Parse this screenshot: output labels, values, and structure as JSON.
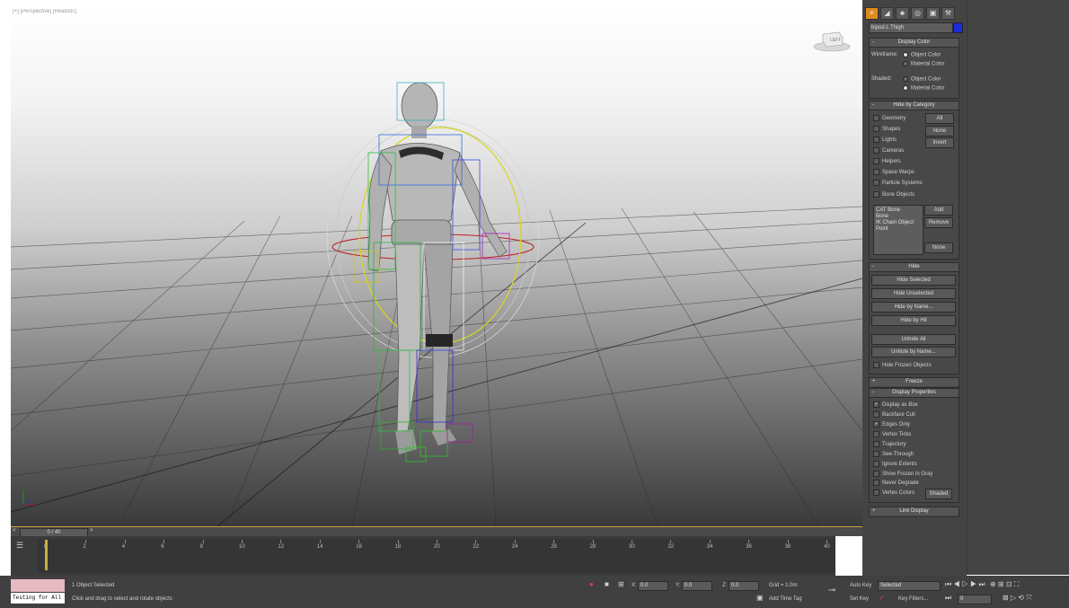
{
  "viewport": {
    "label": "[+] [Perspective] [Realistic]",
    "viewcube_label": "LEFT"
  },
  "command_panel": {
    "tabs": [
      "create",
      "modify",
      "hierarchy",
      "motion",
      "display",
      "utilities"
    ],
    "object_name": "bipod L Thigh",
    "color_swatch": "#1b2dd8",
    "display_color": {
      "title": "Display Color",
      "wireframe_label": "Wireframe:",
      "shaded_label": "Shaded:",
      "opt_object": "Object Color",
      "opt_material": "Material Color"
    },
    "hide_by_category": {
      "title": "Hide by Category",
      "items": [
        "Geometry",
        "Shapes",
        "Lights",
        "Cameras",
        "Helpers",
        "Space Warps",
        "Particle Systems",
        "Bone Objects"
      ],
      "btn_all": "All",
      "btn_none": "None",
      "btn_invert": "Invert",
      "list": [
        "CAT Bone",
        "Bone",
        "IK Chain Object",
        "Point"
      ],
      "btn_add": "Add",
      "btn_remove": "Remove",
      "btn_none2": "None"
    },
    "hide": {
      "title": "Hide",
      "buttons": [
        "Hide Selected",
        "Hide Unselected",
        "Hide by Name...",
        "Hide by Hit",
        "Unhide All",
        "Unhide by Name..."
      ],
      "frozen": "Hide Frozen Objects"
    },
    "freeze": {
      "title": "Freeze"
    },
    "display_properties": {
      "title": "Display Properties",
      "items": [
        "Display as Box",
        "Backface Cull",
        "Edges Only",
        "Vertex Ticks",
        "Trajectory",
        "See-Through",
        "Ignore Extents",
        "Show Frozen in Gray",
        "Never Degrade",
        "Vertex Colors"
      ],
      "checked": [
        true,
        false,
        true,
        false,
        false,
        false,
        false,
        false,
        false,
        false
      ],
      "shaded_btn": "Shaded"
    },
    "link_display": {
      "title": "Link Display"
    }
  },
  "timeline": {
    "slider": "0 / 40",
    "prev": "<",
    "next": ">",
    "ticks": [
      "0",
      "2",
      "4",
      "6",
      "8",
      "10",
      "12",
      "14",
      "16",
      "18",
      "20",
      "22",
      "24",
      "26",
      "28",
      "30",
      "32",
      "34",
      "36",
      "38",
      "40"
    ]
  },
  "status": {
    "maxscript_text": "Testing for All",
    "selected": "1 Object Selected",
    "prompt": "Click and drag to select and rotate objects",
    "x_label": "X:",
    "x_val": "0.0",
    "y_label": "Y:",
    "y_val": "0.0",
    "z_label": "Z:",
    "z_val": "0.0",
    "grid": "Grid = 1.0m",
    "add_time_tag": "Add Time Tag",
    "auto_key": "Auto Key",
    "set_key": "Set Key",
    "selected_dropdown": "Selected",
    "key_filters": "Key Filters...",
    "frame": "0"
  }
}
